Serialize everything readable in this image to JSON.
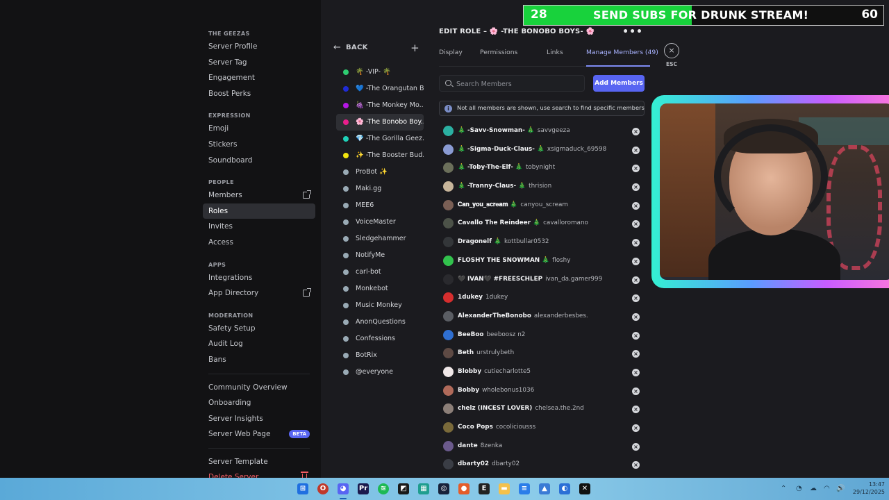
{
  "settings_nav": {
    "sections": [
      {
        "header": "THE GEEZAS",
        "items": [
          {
            "label": "Server Profile"
          },
          {
            "label": "Server Tag"
          },
          {
            "label": "Engagement"
          },
          {
            "label": "Boost Perks"
          }
        ]
      },
      {
        "header": "EXPRESSION",
        "items": [
          {
            "label": "Emoji"
          },
          {
            "label": "Stickers"
          },
          {
            "label": "Soundboard"
          }
        ]
      },
      {
        "header": "PEOPLE",
        "items": [
          {
            "label": "Members",
            "external": true
          },
          {
            "label": "Roles",
            "active": true
          },
          {
            "label": "Invites"
          },
          {
            "label": "Access"
          }
        ]
      },
      {
        "header": "APPS",
        "items": [
          {
            "label": "Integrations"
          },
          {
            "label": "App Directory",
            "external": true
          }
        ]
      },
      {
        "header": "MODERATION",
        "items": [
          {
            "label": "Safety Setup"
          },
          {
            "label": "Audit Log"
          },
          {
            "label": "Bans"
          }
        ]
      },
      {
        "header": "",
        "items": [
          {
            "label": "Community Overview"
          },
          {
            "label": "Onboarding"
          },
          {
            "label": "Server Insights"
          },
          {
            "label": "Server Web Page",
            "badge": "BETA"
          }
        ]
      },
      {
        "header": "",
        "items": [
          {
            "label": "Server Template"
          },
          {
            "label": "Delete Server",
            "danger": true
          }
        ]
      }
    ]
  },
  "roles_panel": {
    "back_label": "BACK",
    "add_label": "+",
    "roles": [
      {
        "name": "🌴 -VIP- 🌴",
        "color": "#2ecc71"
      },
      {
        "name": "💙 -The Orangutan B...",
        "color": "#1f2bd6"
      },
      {
        "name": "🍇 -The Monkey Mo...",
        "color": "#b517e6"
      },
      {
        "name": "🌸 -The Bonobo Boy...",
        "color": "#e91e8c",
        "active": true
      },
      {
        "name": "💎 -The Gorilla Geez...",
        "color": "#1fd1b8"
      },
      {
        "name": "✨ -The Booster Bud...",
        "color": "#f1e40f"
      },
      {
        "name": "ProBot ✨",
        "color": "#99aab5"
      },
      {
        "name": "Maki.gg",
        "color": "#99aab5"
      },
      {
        "name": "MEE6",
        "color": "#99aab5"
      },
      {
        "name": "VoiceMaster",
        "color": "#99aab5"
      },
      {
        "name": "Sledgehammer",
        "color": "#99aab5"
      },
      {
        "name": "NotifyMe",
        "color": "#99aab5"
      },
      {
        "name": "carl-bot",
        "color": "#99aab5"
      },
      {
        "name": "Monkebot",
        "color": "#99aab5"
      },
      {
        "name": "Music Monkey",
        "color": "#99aab5"
      },
      {
        "name": "AnonQuestions",
        "color": "#99aab5"
      },
      {
        "name": "Confessions",
        "color": "#99aab5"
      },
      {
        "name": "BotRix",
        "color": "#99aab5"
      },
      {
        "name": "@everyone",
        "color": "#99aab5"
      }
    ]
  },
  "editor": {
    "title": "EDIT ROLE – 🌸 -THE BONOBO BOYS- 🌸",
    "more_icon": "•••",
    "tabs": [
      {
        "label": "Display"
      },
      {
        "label": "Permissions"
      },
      {
        "label": "Links"
      },
      {
        "label": "Manage Members (49)",
        "active": true
      }
    ],
    "search_placeholder": "Search Members",
    "add_button": "Add Members",
    "notice": "Not all members are shown, use search to find specific members",
    "members": [
      {
        "display": "🎄 -Savv-Snowman- 🎄",
        "user": "savvgeeza",
        "color": "#2bb0a2"
      },
      {
        "display": "🎄 -Sigma-Duck-Claus- 🎄",
        "user": "xsigmaduck_69598",
        "color": "#8a9bd3"
      },
      {
        "display": "🎄 -Toby-The-Elf- 🎄",
        "user": "tobynight",
        "color": "#6b6f5a"
      },
      {
        "display": "🎄 -Tranny-Claus- 🎄",
        "user": "thrision",
        "color": "#c7b59a"
      },
      {
        "display": "𝐂𝐚𝐧_𝐲𝐨𝐮_𝐬𝐜𝐫𝐞𝐚𝐦 🎄",
        "user": "canyou_scream",
        "color": "#7a5f55"
      },
      {
        "display": "Cavallo The Reindeer 🎄",
        "user": "cavalloromano",
        "color": "#4c5248"
      },
      {
        "display": "Dragonelf 🎄",
        "user": "kottbullar0532",
        "color": "#333639"
      },
      {
        "display": "FLOSHY THE SNOWMAN 🎄",
        "user": "floshy",
        "color": "#32c24d"
      },
      {
        "display": "🖤 IVAN🖤 #FREESCHLEP",
        "user": "ivan_da.gamer999",
        "color": "#2a2a2e"
      },
      {
        "display": "1dukey",
        "user": "1dukey",
        "color": "#d62e2e"
      },
      {
        "display": "AlexanderTheBonobo",
        "user": "alexanderbesbes.",
        "color": "#5a5d63"
      },
      {
        "display": "BeeBoo",
        "user": "beeboosz n2",
        "color": "#2f6fd1"
      },
      {
        "display": "Beth",
        "user": "urstrulybeth",
        "color": "#5e4a44"
      },
      {
        "display": "Blobby",
        "user": "cutiecharlotte5",
        "color": "#f0e8e8"
      },
      {
        "display": "Bobby",
        "user": "wholebonus1036",
        "color": "#b06a5a"
      },
      {
        "display": "chelz (INCEST LOVER)",
        "user": "chelsea.the.2nd",
        "color": "#8c7f78"
      },
      {
        "display": "Coco Pops",
        "user": "cocoliciousss",
        "color": "#7a6a3a"
      },
      {
        "display": "dante",
        "user": "8zenka",
        "color": "#6b5a8c"
      },
      {
        "display": "dbarty02",
        "user": "dbarty02",
        "color": "#3a3d45"
      }
    ],
    "remove_icon": "×"
  },
  "esc": {
    "icon": "×",
    "label": "ESC"
  },
  "stream_overlay": {
    "sub_count": "28",
    "sub_goal": "60",
    "sub_progress": 0.467,
    "banner_text": "SEND SUBS FOR DRUNK STREAM!",
    "accent": "#18d23c"
  },
  "taskbar": {
    "time": "13:47",
    "date": "29/12/2025"
  }
}
